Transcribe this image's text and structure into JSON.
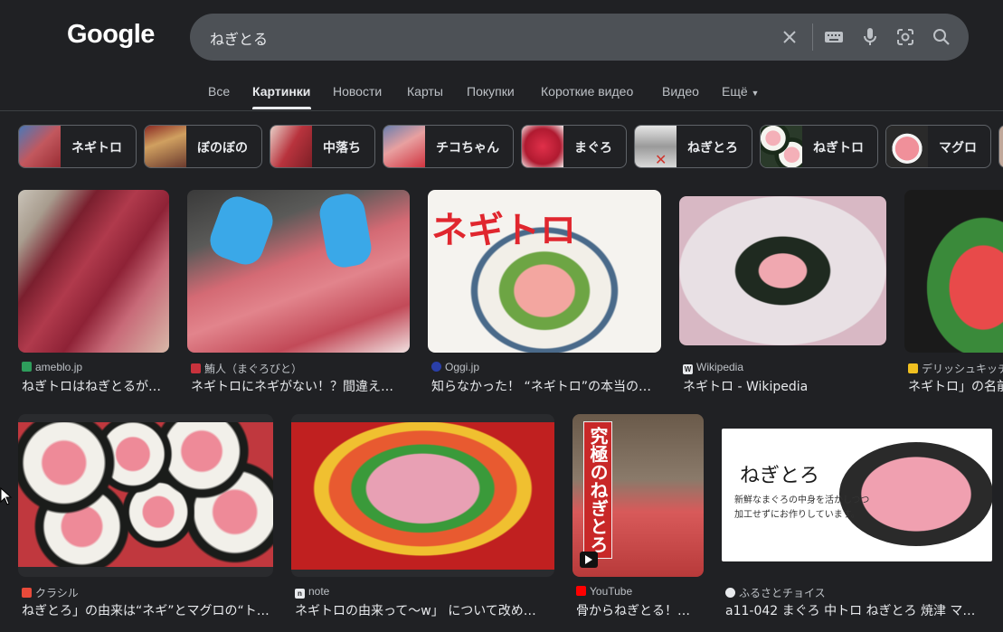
{
  "logo": "Google",
  "search": {
    "query": "ねぎとる"
  },
  "tabs": [
    {
      "label": "Все"
    },
    {
      "label": "Картинки"
    },
    {
      "label": "Новости"
    },
    {
      "label": "Карты"
    },
    {
      "label": "Покупки"
    },
    {
      "label": "Короткие видео"
    },
    {
      "label": "Видео"
    },
    {
      "label": "Ещё"
    }
  ],
  "chips": [
    {
      "label": "ネギトロ"
    },
    {
      "label": "ぼのぼの"
    },
    {
      "label": "中落ち"
    },
    {
      "label": "チコちゃん"
    },
    {
      "label": "まぐろ"
    },
    {
      "label": "ねぎとろ"
    },
    {
      "label": "ねぎトロ"
    },
    {
      "label": "マグロ"
    }
  ],
  "results_row1": [
    {
      "source": "ameblo.jp",
      "title": "ねぎトロはねぎとるが…",
      "image_text": ""
    },
    {
      "source": "鮪人（まぐろびと）",
      "title": "ネギトロにネギがない！？間違え…",
      "image_text": ""
    },
    {
      "source": "Oggi.jp",
      "title": "知らなかった！ “ネギトロ”の本当の…",
      "image_text": "ネギトロ"
    },
    {
      "source": "Wikipedia",
      "title": "ネギトロ - Wikipedia",
      "image_text": ""
    },
    {
      "source": "デリッシュキッチ",
      "title": "ネギトロ」の名前",
      "image_text": ""
    }
  ],
  "results_row2": [
    {
      "source": "クラシル",
      "title": "ねぎとろ」の由来は“ネギ”とマグロの“ト…",
      "image_text": ""
    },
    {
      "source": "note",
      "title": "ネギトロの由来って〜w」 について改め…",
      "image_text": ""
    },
    {
      "source": "YouTube",
      "title": "骨からねぎとる！…",
      "image_text": "究極のねぎとろ"
    },
    {
      "source": "ふるさとチョイス",
      "title": "a11-042 まぐろ 中トロ ねぎとろ 焼津 マグ…",
      "image_text": "ねぎとろ",
      "image_subtext": "新鮮なまぐろの中身を活かしつつ加工せずにお作りしています。"
    }
  ],
  "colors": {
    "bg": "#202124",
    "searchbar": "#4d5156",
    "text": "#e8eaed",
    "muted": "#bdc1c6",
    "border": "#5f6368"
  }
}
